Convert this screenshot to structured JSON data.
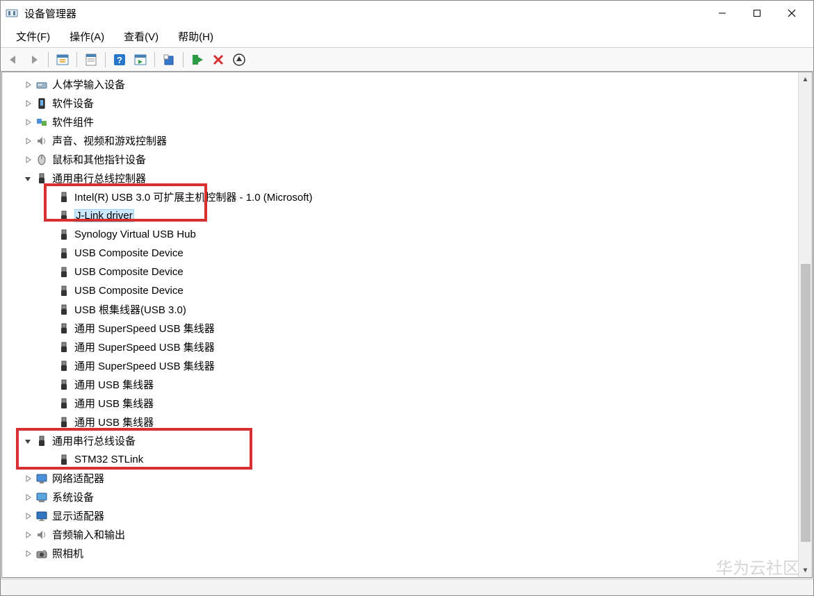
{
  "window": {
    "title": "设备管理器"
  },
  "menu": {
    "file": "文件(F)",
    "action": "操作(A)",
    "view": "查看(V)",
    "help": "帮助(H)"
  },
  "categories": [
    {
      "label": "人体学输入设备",
      "icon": "hid-icon",
      "expanded": false
    },
    {
      "label": "软件设备",
      "icon": "software-device-icon",
      "expanded": false
    },
    {
      "label": "软件组件",
      "icon": "software-component-icon",
      "expanded": false
    },
    {
      "label": "声音、视频和游戏控制器",
      "icon": "audio-icon",
      "expanded": false
    },
    {
      "label": "鼠标和其他指针设备",
      "icon": "mouse-icon",
      "expanded": false
    },
    {
      "label": "通用串行总线控制器",
      "icon": "usb-icon",
      "expanded": true,
      "children": [
        {
          "label": "Intel(R) USB 3.0 可扩展主机控制器 - 1.0 (Microsoft)",
          "icon": "usb-plug-icon"
        },
        {
          "label": "J-Link driver",
          "icon": "usb-plug-icon",
          "selected": true
        },
        {
          "label": "Synology Virtual USB Hub",
          "icon": "usb-plug-icon"
        },
        {
          "label": "USB Composite Device",
          "icon": "usb-plug-icon"
        },
        {
          "label": "USB Composite Device",
          "icon": "usb-plug-icon"
        },
        {
          "label": "USB Composite Device",
          "icon": "usb-plug-icon"
        },
        {
          "label": "USB 根集线器(USB 3.0)",
          "icon": "usb-plug-icon"
        },
        {
          "label": "通用 SuperSpeed USB 集线器",
          "icon": "usb-plug-icon"
        },
        {
          "label": "通用 SuperSpeed USB 集线器",
          "icon": "usb-plug-icon"
        },
        {
          "label": "通用 SuperSpeed USB 集线器",
          "icon": "usb-plug-icon"
        },
        {
          "label": "通用 USB 集线器",
          "icon": "usb-plug-icon"
        },
        {
          "label": "通用 USB 集线器",
          "icon": "usb-plug-icon"
        },
        {
          "label": "通用 USB 集线器",
          "icon": "usb-plug-icon"
        }
      ]
    },
    {
      "label": "通用串行总线设备",
      "icon": "usb-icon",
      "expanded": true,
      "children": [
        {
          "label": "STM32 STLink",
          "icon": "usb-plug-icon"
        }
      ]
    },
    {
      "label": "网络适配器",
      "icon": "network-icon",
      "expanded": false
    },
    {
      "label": "系统设备",
      "icon": "system-device-icon",
      "expanded": false
    },
    {
      "label": "显示适配器",
      "icon": "display-icon",
      "expanded": false
    },
    {
      "label": "音频输入和输出",
      "icon": "audio-io-icon",
      "expanded": false
    },
    {
      "label": "照相机",
      "icon": "camera-icon",
      "expanded": false
    }
  ],
  "watermark": "华为云社区"
}
